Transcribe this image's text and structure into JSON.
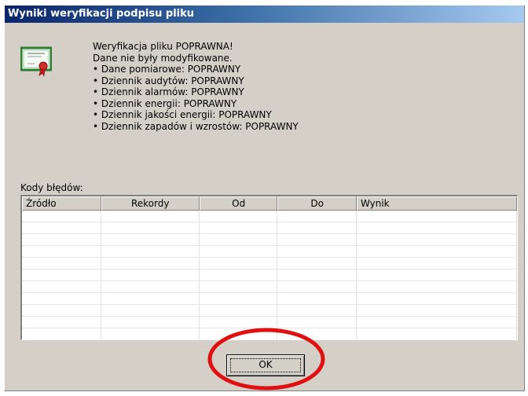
{
  "window": {
    "title": "Wyniki weryfikacji podpisu pliku"
  },
  "message": {
    "lines": [
      "Weryfikacja pliku POPRAWNA!",
      "Dane nie były modyfikowane.",
      "• Dane pomiarowe: POPRAWNY",
      "• Dziennik audytów: POPRAWNY",
      "• Dziennik alarmów: POPRAWNY",
      "• Dziennik energii: POPRAWNY",
      "• Dziennik jakości energii: POPRAWNY",
      "• Dziennik zapadów i wzrostów: POPRAWNY"
    ]
  },
  "error_codes": {
    "label": "Kody błędów:",
    "columns": [
      "Źródło",
      "Rekordy",
      "Od",
      "Do",
      "Wynik"
    ],
    "rows": []
  },
  "buttons": {
    "ok": "OK"
  },
  "icons": {
    "certificate": "certificate-icon"
  },
  "colors": {
    "annotation_circle": "#e01010",
    "titlebar": "#0a246a"
  }
}
